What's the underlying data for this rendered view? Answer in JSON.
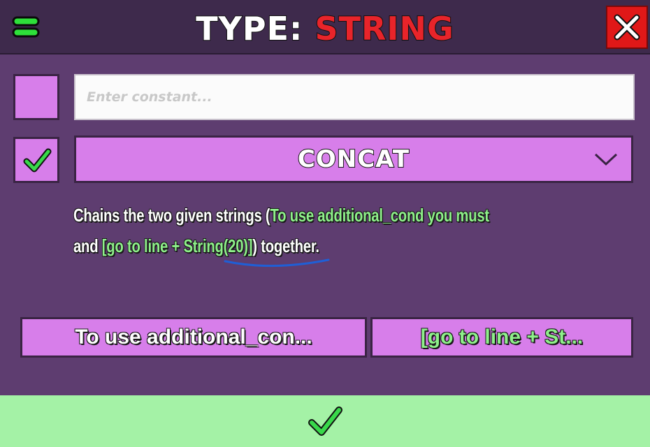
{
  "header": {
    "title_prefix": "TYPE: ",
    "title_type": "STRING",
    "title_prefix_color": "#ffffff",
    "title_type_color": "#e8242a",
    "menu_icon": "menu-icon",
    "close_icon": "close-icon"
  },
  "constant": {
    "enabled": false,
    "placeholder": "Enter constant...",
    "value": ""
  },
  "function": {
    "enabled": true,
    "selected": "CONCAT"
  },
  "description": {
    "part1": "Chains the two given strings (",
    "arg1": "To use additional_cond you must",
    "part2": "and ",
    "arg2a": "[go to line  + ",
    "arg2b": "String(20)]",
    "part3": ") together.",
    "highlight_color": "#8ef08a"
  },
  "options": [
    {
      "label": "To use additional_con..."
    },
    {
      "label": "[go to line  + St..."
    }
  ],
  "confirm": {
    "icon": "check-icon",
    "color": "#a4f2a6"
  }
}
